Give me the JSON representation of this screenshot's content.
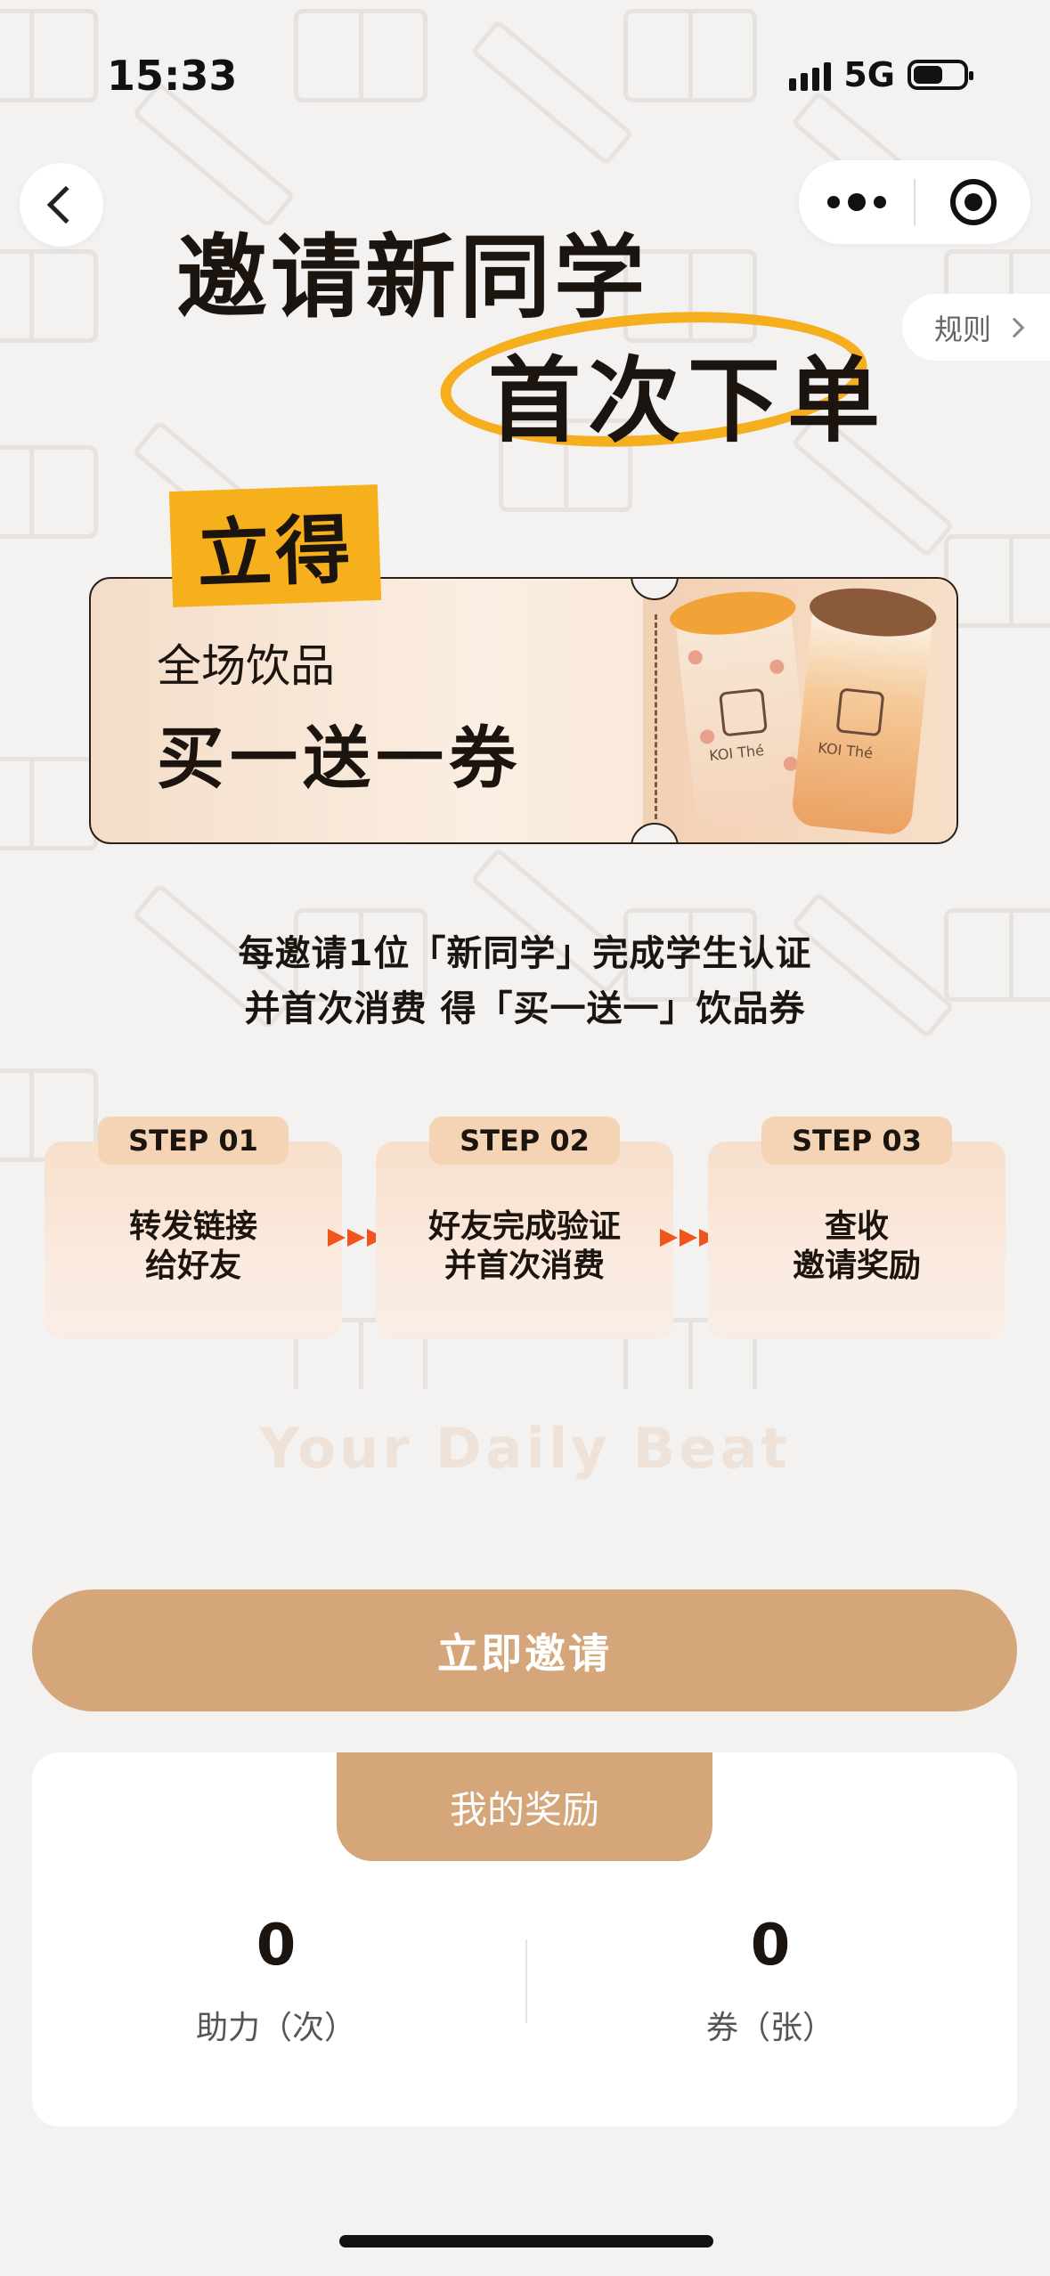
{
  "status_bar": {
    "time": "15:33",
    "network": "5G"
  },
  "nav": {
    "rules_label": "规则"
  },
  "headline": {
    "line1": "邀请新同学",
    "line2": "首次下单"
  },
  "coupon": {
    "tag": "立得",
    "subtitle": "全场饮品",
    "title": "买一送一券",
    "brand": "KOI Thé"
  },
  "description": {
    "line1": "每邀请1位「新同学」完成学生认证",
    "line2": "并首次消费 得「买一送一」饮品券"
  },
  "steps": [
    {
      "label": "STEP 01",
      "line1": "转发链接",
      "line2": "给好友"
    },
    {
      "label": "STEP 02",
      "line1": "好友完成验证",
      "line2": "并首次消费"
    },
    {
      "label": "STEP 03",
      "line1": "查收",
      "line2": "邀请奖励"
    }
  ],
  "slogan": "Your Daily Beat",
  "invite_button": "立即邀请",
  "rewards": {
    "tab_label": "我的奖励",
    "stats": [
      {
        "value": "0",
        "label": "助力（次）"
      },
      {
        "value": "0",
        "label": "券（张）"
      }
    ]
  },
  "colors": {
    "accent": "#d4a679",
    "highlight": "#f5b01c",
    "arrow": "#f0551e"
  },
  "icons": [
    "back-icon",
    "more-icon",
    "target-icon",
    "chevron-right-icon",
    "signal-icon",
    "battery-icon"
  ]
}
